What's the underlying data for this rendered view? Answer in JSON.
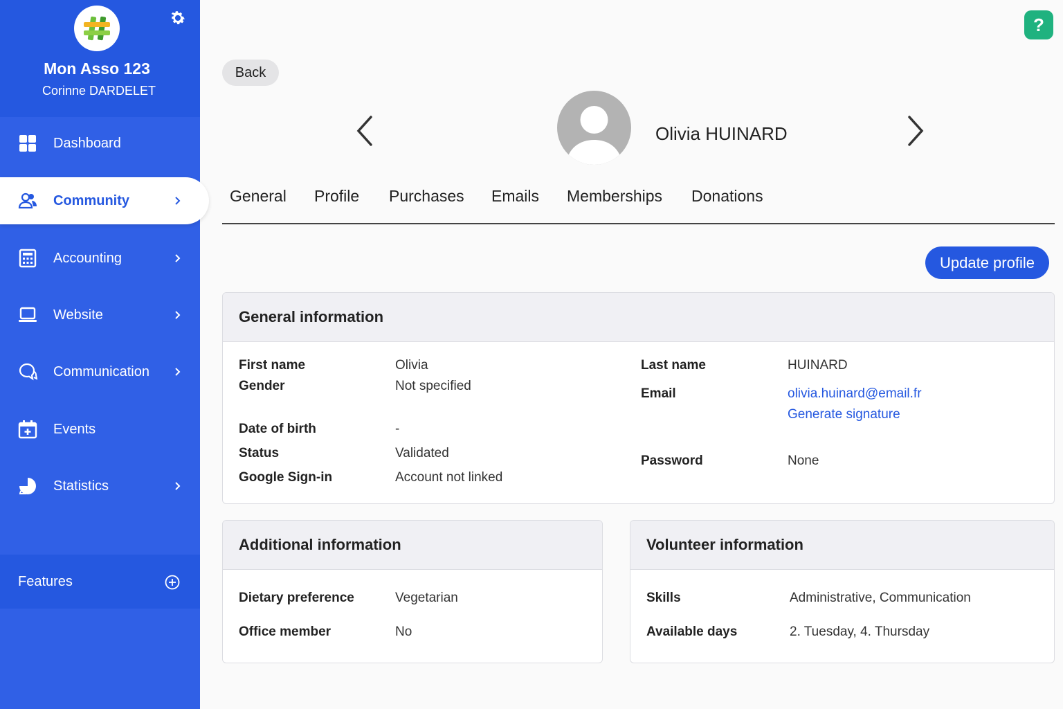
{
  "sidebar": {
    "org_name": "Mon Asso 123",
    "user_name": "Corinne DARDELET",
    "items": [
      {
        "label": "Dashboard",
        "icon": "dashboard-icon"
      },
      {
        "label": "Community",
        "icon": "community-icon",
        "active": true
      },
      {
        "label": "Accounting",
        "icon": "calculator-icon"
      },
      {
        "label": "Website",
        "icon": "laptop-icon"
      },
      {
        "label": "Communication",
        "icon": "chat-icon"
      },
      {
        "label": "Events",
        "icon": "calendar-icon"
      },
      {
        "label": "Statistics",
        "icon": "pie-chart-icon"
      }
    ],
    "features_label": "Features"
  },
  "header": {
    "help_label": "?",
    "back_label": "Back",
    "member_name": "Olivia HUINARD"
  },
  "tabs": [
    "General",
    "Profile",
    "Purchases",
    "Emails",
    "Memberships",
    "Donations"
  ],
  "update_label": "Update profile",
  "general": {
    "title": "General information",
    "first_name_label": "First name",
    "first_name": "Olivia",
    "gender_label": "Gender",
    "gender": "Not specified",
    "dob_label": "Date of birth",
    "dob": "-",
    "status_label": "Status",
    "status": "Validated",
    "google_label": "Google Sign-in",
    "google": "Account not linked",
    "last_name_label": "Last name",
    "last_name": "HUINARD",
    "email_label": "Email",
    "email": "olivia.huinard@email.fr",
    "signature_link": "Generate signature",
    "password_label": "Password",
    "password": "None"
  },
  "additional": {
    "title": "Additional information",
    "diet_label": "Dietary preference",
    "diet": "Vegetarian",
    "office_label": "Office member",
    "office": "No"
  },
  "volunteer": {
    "title": "Volunteer information",
    "skills_label": "Skills",
    "skills": "Administrative, Communication",
    "days_label": "Available days",
    "days": "2. Tuesday, 4. Thursday"
  },
  "colors": {
    "primary": "#2558e0",
    "sidebar": "#3060e6",
    "help": "#1fb27f"
  }
}
